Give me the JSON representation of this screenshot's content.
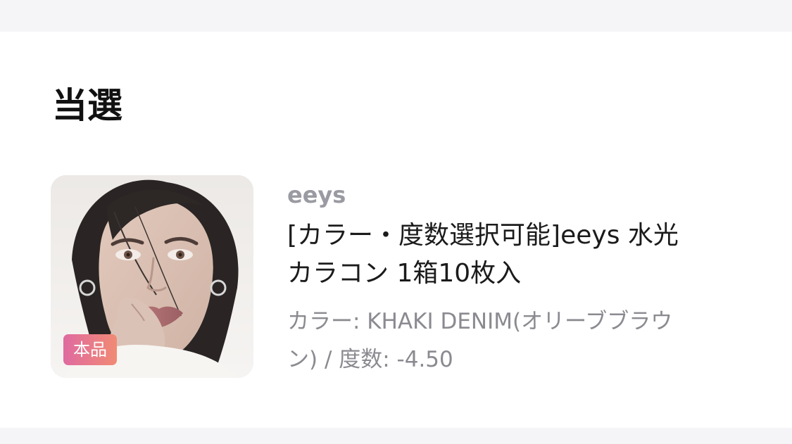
{
  "section": {
    "title": "当選"
  },
  "product": {
    "badge": "本品",
    "brand": "eeys",
    "title_lines": [
      "[カラー・度数選択可能]eeys 水光",
      "カラコン 1箱10枚入"
    ],
    "meta_lines": [
      "カラー: KHAKI DENIM(オリーブブラウ",
      "ン) / 度数: -4.50"
    ]
  }
}
